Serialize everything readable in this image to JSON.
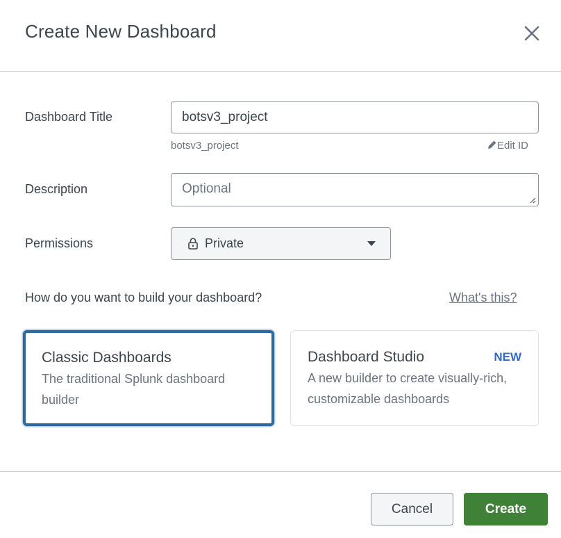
{
  "dialog": {
    "title": "Create New Dashboard",
    "close_icon": "close-icon"
  },
  "form": {
    "title_label": "Dashboard Title",
    "title_value": "botsv3_project",
    "dashboard_id": "botsv3_project",
    "edit_id_label": "Edit ID",
    "edit_id_icon": "pencil-icon",
    "description_label": "Description",
    "description_value": "",
    "description_placeholder": "Optional",
    "permissions_label": "Permissions",
    "permissions_value": "Private",
    "permissions_icon": "lock-icon"
  },
  "builder": {
    "question": "How do you want to build your dashboard?",
    "help_link": "What's this?",
    "options": [
      {
        "title": "Classic Dashboards",
        "description": "The traditional Splunk dashboard builder",
        "selected": true
      },
      {
        "title": "Dashboard Studio",
        "description": "A new builder to create visually-rich, customizable dashboards",
        "badge": "NEW",
        "selected": false
      }
    ]
  },
  "footer": {
    "cancel_label": "Cancel",
    "create_label": "Create"
  },
  "colors": {
    "primary_green": "#3f8237",
    "selected_border": "#2c6aa0",
    "new_badge": "#3568c6"
  }
}
